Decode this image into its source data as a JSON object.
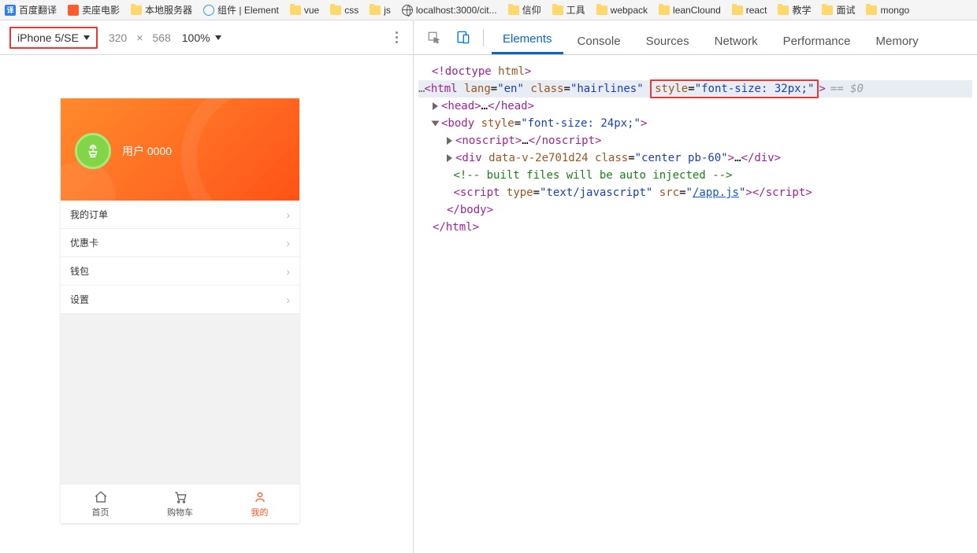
{
  "bookmarks": [
    {
      "icon": "blue",
      "label": "百度翻译"
    },
    {
      "icon": "orange",
      "label": "卖座电影"
    },
    {
      "icon": "folder",
      "label": "本地服务器"
    },
    {
      "icon": "elem",
      "label": "组件 | Element"
    },
    {
      "icon": "folder",
      "label": "vue"
    },
    {
      "icon": "folder",
      "label": "css"
    },
    {
      "icon": "folder",
      "label": "js"
    },
    {
      "icon": "globe",
      "label": "localhost:3000/cit..."
    },
    {
      "icon": "folder",
      "label": "信仰"
    },
    {
      "icon": "folder",
      "label": "工具"
    },
    {
      "icon": "folder",
      "label": "webpack"
    },
    {
      "icon": "folder",
      "label": "leanClound"
    },
    {
      "icon": "folder",
      "label": "react"
    },
    {
      "icon": "folder",
      "label": "教学"
    },
    {
      "icon": "folder",
      "label": "面试"
    },
    {
      "icon": "folder",
      "label": "mongo"
    }
  ],
  "deviceToolbar": {
    "device": "iPhone 5/SE",
    "width": "320",
    "times": "×",
    "height": "568",
    "zoom": "100%"
  },
  "phone": {
    "username": "用户 0000",
    "menu": [
      "我的订单",
      "优惠卡",
      "钱包",
      "设置"
    ],
    "tabbar": [
      {
        "label": "首页",
        "icon": "⌂"
      },
      {
        "label": "购物车",
        "icon": "🛒"
      },
      {
        "label": "我的",
        "icon": "👤"
      }
    ]
  },
  "devtoolsTabs": [
    "Elements",
    "Console",
    "Sources",
    "Network",
    "Performance",
    "Memory"
  ],
  "code": {
    "doctype": "<!doctype html>",
    "html_open_pre": "<html lang=\"en\" class=\"hairlines\"",
    "html_style_attr": " style=\"font-size: 32px;\"",
    "html_open_post": ">",
    "eq_zero": "== $0",
    "head": "<head>…</head>",
    "body_open": "<body style=\"font-size: 24px;\">",
    "noscript": "<noscript>…</noscript>",
    "div": "<div data-v-2e701d24 class=\"center pb-60\">…</div>",
    "comment": "<!-- built files will be auto injected -->",
    "script": "<script type=\"text/javascript\" src=\"/app.js\"></",
    "script2": "script>",
    "body_close": "</body>",
    "html_close": "</html>"
  }
}
